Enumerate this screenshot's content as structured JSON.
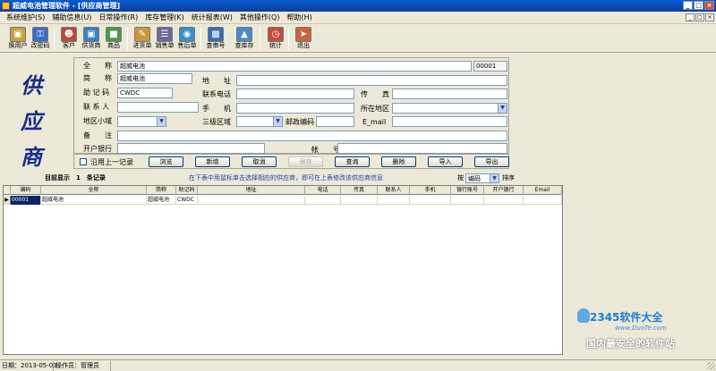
{
  "window": {
    "title": "超威电池管理软件 - [供应商管理]",
    "min_glyph": "_",
    "max_glyph": "□",
    "close_glyph": "×"
  },
  "menu": {
    "items": [
      "系统维护(S)",
      "辅助信息(U)",
      "日常操作(R)",
      "库存管理(K)",
      "统计报表(W)",
      "其他操作(Q)",
      "帮助(H)"
    ]
  },
  "toolbar": {
    "buttons": [
      {
        "label": "换用户",
        "icon": "lock-icon",
        "color": "#c8a13a"
      },
      {
        "label": "改密码",
        "icon": "key-icon",
        "color": "#3a6fc8"
      },
      {
        "label": "客户",
        "icon": "person-icon",
        "color": "#b84b3a"
      },
      {
        "label": "供货商",
        "icon": "truck-icon",
        "color": "#3a7fc8"
      },
      {
        "label": "商品",
        "icon": "box-icon",
        "color": "#4a9a4a"
      },
      {
        "label": "进货单",
        "icon": "pen-icon",
        "color": "#c89a3a"
      },
      {
        "label": "销售单",
        "icon": "note-icon",
        "color": "#6a6a9a"
      },
      {
        "label": "售后单",
        "icon": "disc-icon",
        "color": "#3a8fc8"
      },
      {
        "label": "查串号",
        "icon": "clipboard-icon",
        "color": "#3a6ab8"
      },
      {
        "label": "查库存",
        "icon": "chart-icon",
        "color": "#4a8ac8"
      },
      {
        "label": "统计",
        "icon": "clock-icon",
        "color": "#c84a3a"
      },
      {
        "label": "退出",
        "icon": "exit-icon",
        "color": "#c8643a"
      }
    ]
  },
  "logo": {
    "text": "供应商"
  },
  "form": {
    "full_name_label": "全　　称",
    "full_name_value": "超威电池",
    "code_value": "00001",
    "short_name_label": "简　　称",
    "short_name_value": "超威电池",
    "address_label": "地　　址",
    "address_value": "",
    "mnemonic_label": "助 记 码",
    "mnemonic_value": "CWDC",
    "phone_label": "联系电话",
    "phone_value": "",
    "fax_label": "传　　真",
    "fax_value": "",
    "contact_label": "联 系 人",
    "contact_value": "",
    "mobile_label": "手　　机",
    "mobile_value": "",
    "region_label": "所在地区",
    "region_value": "",
    "subregion_label": "地区小域",
    "level3_label": "三级区域",
    "zip_label": "邮政编码",
    "zip_value": "",
    "email_label": "E_mail",
    "email_value": "",
    "remark_label": "备　　注",
    "remark_value": "",
    "bank_label": "开户银行",
    "bank_value": "",
    "account_label": "帐　　号",
    "account_value": ""
  },
  "actions": {
    "reuse_label": "沿用上一记录",
    "browse": "浏览",
    "add": "新增",
    "cancel": "取消",
    "save": "保存",
    "query": "查询",
    "delete": "删除",
    "import": "导入",
    "export": "导出"
  },
  "info": {
    "count_text": "目前显示　1　条记录",
    "hint_text": "在下表中用鼠标单击选择相应的供应商，即可在上表修改该供应商信息",
    "sort_by_label": "按",
    "sort_field": "编码",
    "sort_label": "排序"
  },
  "grid": {
    "columns": [
      "编码",
      "全称",
      "简称",
      "助记码",
      "地址",
      "电话",
      "传真",
      "联系人",
      "手机",
      "银行账号",
      "开户银行",
      "Email"
    ],
    "rows": [
      [
        "00001",
        "超威电池",
        "超威电池",
        "CWDC",
        "",
        "",
        "",
        "",
        "",
        "",
        "",
        ""
      ]
    ],
    "row_indicator": "▶"
  },
  "watermark": {
    "brand": "2345软件大全",
    "site": "www.DuoTe.com",
    "slogan": "国内最安全的软件站"
  },
  "status": {
    "date": "日期：2013-05-03",
    "operator": "操作员：管理员"
  }
}
